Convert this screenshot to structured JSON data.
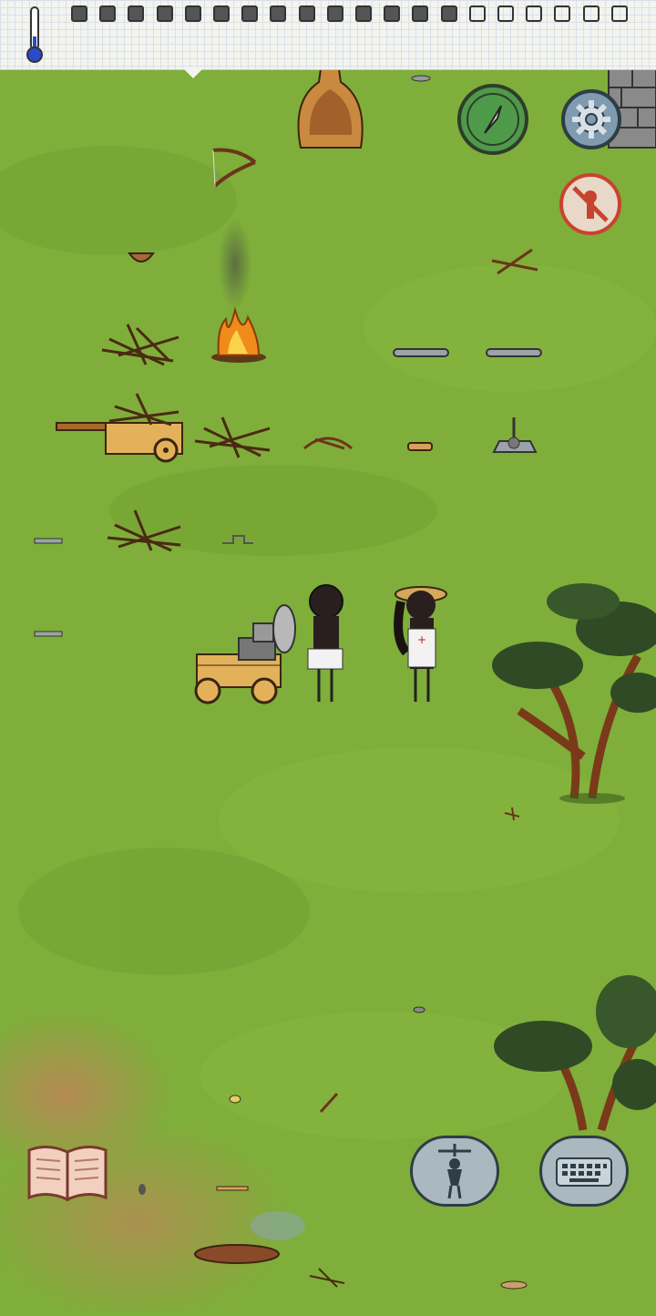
{
  "hud": {
    "temperature_icon": "thermometer-icon",
    "food_meter": {
      "filled": 14,
      "total": 20
    },
    "compass_icon": "compass-icon",
    "settings_icon": "gear-icon",
    "no_kill_icon": "no-kill-icon",
    "emote_icon": "puppet-icon",
    "chat_icon": "keyboard-icon",
    "tech_book_icon": "book-icon"
  },
  "colors": {
    "grass": "#7fae3a",
    "grass_dark": "#5f8e2c",
    "dirt": "#b58a55",
    "compass_green": "#4f9a4a",
    "settings_blue": "#7f9bb0",
    "no_kill_red": "#c8432f",
    "bubble_blue": "#aab8c0"
  }
}
